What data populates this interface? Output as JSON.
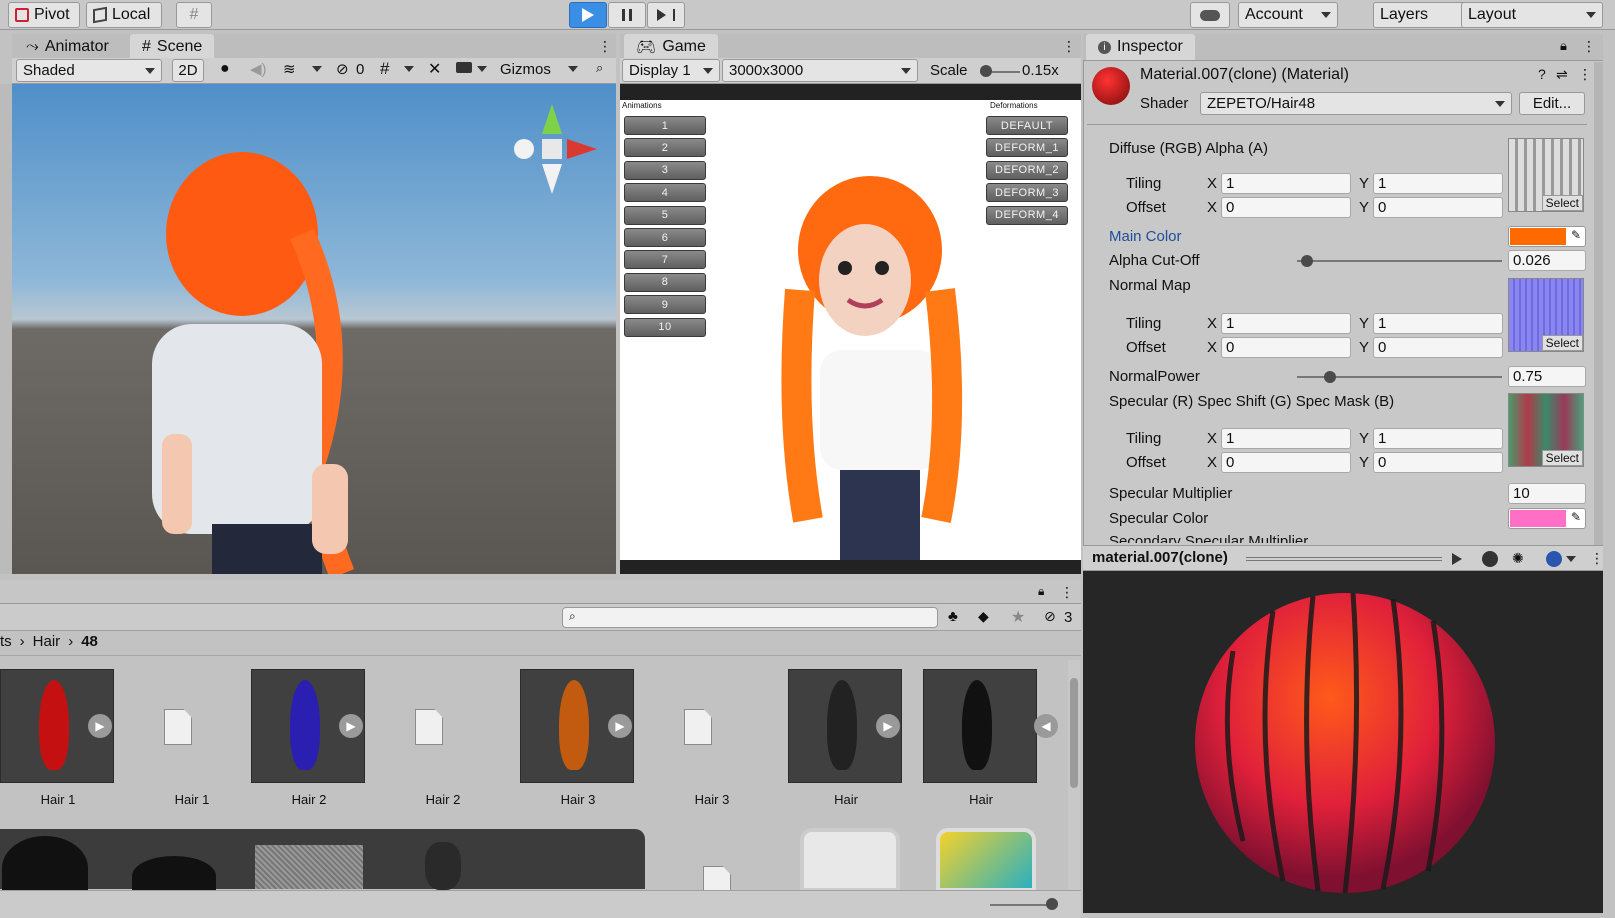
{
  "toolbar": {
    "pivot_label": "Pivot",
    "local_label": "Local",
    "account_label": "Account",
    "layers_label": "Layers",
    "layout_label": "Layout"
  },
  "scene_panel": {
    "tabs": [
      "Animator",
      "Scene"
    ],
    "shading_mode": "Shaded",
    "mode_2d": "2D",
    "hidden_count": "0",
    "gizmos_label": "Gizmos"
  },
  "game_panel": {
    "tab": "Game",
    "display": "Display 1",
    "resolution": "3000x3000",
    "scale_label": "Scale",
    "scale_value": "0.15x",
    "animations_heading": "Animations",
    "deformations_heading": "Deformations",
    "animation_buttons": [
      "1",
      "2",
      "3",
      "4",
      "5",
      "6",
      "7",
      "8",
      "9",
      "10"
    ],
    "deform_buttons": [
      "DEFAULT",
      "DEFORM_1",
      "DEFORM_2",
      "DEFORM_3",
      "DEFORM_4"
    ]
  },
  "inspector": {
    "tab": "Inspector",
    "material_title": "Material.007(clone) (Material)",
    "shader_label": "Shader",
    "shader_value": "ZEPETO/Hair48",
    "edit_label": "Edit...",
    "diffuse_label": "Diffuse (RGB) Alpha (A)",
    "tiling_label": "Tiling",
    "offset_label": "Offset",
    "x_label": "X",
    "y_label": "Y",
    "diffuse_tiling": [
      "1",
      "1"
    ],
    "diffuse_offset": [
      "0",
      "0"
    ],
    "main_color_label": "Main Color",
    "main_color_hex": "#ff6a00",
    "alpha_cutoff_label": "Alpha Cut-Off",
    "alpha_cutoff_value": "0.026",
    "normal_map_label": "Normal Map",
    "normal_tiling": [
      "1",
      "1"
    ],
    "normal_offset": [
      "0",
      "0"
    ],
    "normal_power_label": "NormalPower",
    "normal_power_value": "0.75",
    "specular_tex_label": "Specular (R) Spec Shift (G) Spec Mask (B)",
    "specular_tiling": [
      "1",
      "1"
    ],
    "specular_offset": [
      "0",
      "0"
    ],
    "specular_multiplier_label": "Specular Multiplier",
    "specular_multiplier_value": "10",
    "specular_color_label": "Specular Color",
    "specular_color_hex": "#ff6fc6",
    "secondary_label": "Secondary Specular Multiplier",
    "select_label": "Select",
    "preview_title": "material.007(clone)"
  },
  "project": {
    "breadcrumb": [
      "ts",
      "Hair",
      "48"
    ],
    "hidden_count": "3",
    "assets": [
      {
        "name": "Hair 1",
        "kind": "model",
        "color": "#c41010"
      },
      {
        "name": "Hair 1",
        "kind": "file"
      },
      {
        "name": "Hair 2",
        "kind": "model",
        "color": "#2a1fb0"
      },
      {
        "name": "Hair 2",
        "kind": "file"
      },
      {
        "name": "Hair 3",
        "kind": "model",
        "color": "#c25a10"
      },
      {
        "name": "Hair 3",
        "kind": "file"
      },
      {
        "name": "Hair",
        "kind": "model",
        "color": "#222222"
      },
      {
        "name": "Hair",
        "kind": "model",
        "color": "#111111"
      }
    ]
  }
}
